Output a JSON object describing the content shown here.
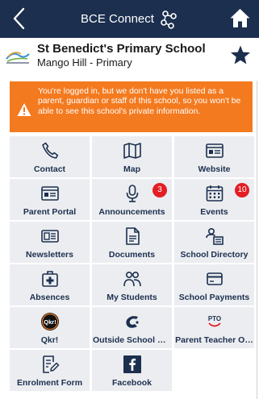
{
  "header": {
    "title": "BCE Connect",
    "back_icon": "chevron-left-icon",
    "home_icon": "home-icon"
  },
  "school": {
    "name": "St Benedict's Primary School",
    "subtitle": "Mango Hill - Primary",
    "favourite_icon": "star-icon"
  },
  "banner": {
    "message": "You're logged in, but we don't have you listed as a parent, guardian or staff of this school, so you won't be able to see this school's private information.",
    "color": "#f47a1f"
  },
  "tiles": [
    {
      "label": "Contact",
      "icon": "phone-icon"
    },
    {
      "label": "Map",
      "icon": "map-icon"
    },
    {
      "label": "Website",
      "icon": "website-icon"
    },
    {
      "label": "Parent Portal",
      "icon": "portal-icon"
    },
    {
      "label": "Announcements",
      "icon": "microphone-icon",
      "badge": "3"
    },
    {
      "label": "Events",
      "icon": "calendar-icon",
      "badge": "10"
    },
    {
      "label": "Newsletters",
      "icon": "newspaper-icon"
    },
    {
      "label": "Documents",
      "icon": "document-icon"
    },
    {
      "label": "School Directory",
      "icon": "directory-icon"
    },
    {
      "label": "Absences",
      "icon": "medical-kit-icon"
    },
    {
      "label": "My Students",
      "icon": "students-icon"
    },
    {
      "label": "School Payments",
      "icon": "card-icon"
    },
    {
      "label": "Qkr!",
      "icon": "qkr-logo-icon"
    },
    {
      "label": "Outside School H…",
      "icon": "oshc-logo-icon"
    },
    {
      "label": "Parent Teacher O…",
      "icon": "pto-logo-icon"
    },
    {
      "label": "Enrolment Form",
      "icon": "form-edit-icon"
    },
    {
      "label": "Facebook",
      "icon": "facebook-icon"
    }
  ],
  "colors": {
    "header": "#1c2f4f",
    "tile_bg": "#ebedf0",
    "badge": "#e31e24",
    "icon": "#1c2f4f"
  }
}
